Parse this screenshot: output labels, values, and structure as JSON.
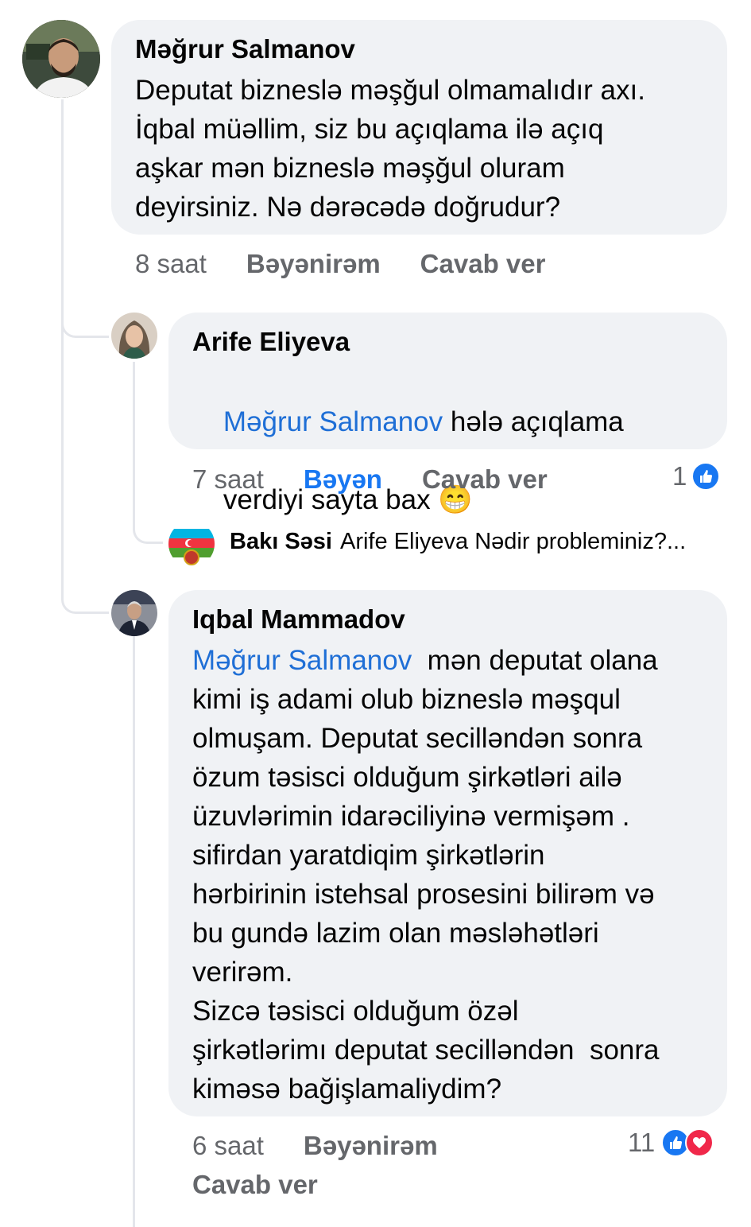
{
  "comments": [
    {
      "author": "Məğrur Salmanov",
      "text": "Deputat bizneslə məşğul olmamalıdır axı.\nİqbal müəllim, siz bu açıqlama ilə açıq\naşkar mən bizneslə məşğul oluram\ndeyirsiniz. Nə dərəcədə doğrudur?",
      "time": "8 saat",
      "like_label": "Bəyənirəm",
      "reply_label": "Cavab ver"
    },
    {
      "author": "Arife Eliyeva",
      "mention": "Məğrur Salmanov",
      "text_line1": " hələ açıqlama",
      "text_line2": "verdiyi sayta bax ",
      "emoji": "😁",
      "time": "7 saat",
      "like_label": "Bəyən",
      "reply_label": "Cavab ver",
      "reaction_count": "1"
    },
    {
      "author": "Iqbal Mammadov",
      "mention": "Məğrur Salmanov",
      "text_first": "  mən deputat olana",
      "text": "kimi iş adami olub bizneslə məşqul\nolmuşam. Deputat secilləndən sonra\nözum təsisci olduğum şirkətləri ailə\nüzuvlərimin idarəciliyinə vermişəm .\nsifirdan yaratdiqim şirkətlərin\nhərbirinin istehsal prosesini bilirəm və\nbu gundə lazim olan məsləhətləri\nverirəm.\nSizcə təsisci olduğum özəl\nşirkətlərimı deputat secilləndən  sonra\nkiməsə bağişlamaliydim?",
      "time": "6 saat",
      "like_label": "Bəyənirəm",
      "reply_label": "Cavab ver",
      "reaction_count": "11"
    }
  ],
  "reply_preview": {
    "author": "Bakı Səsi",
    "text": "Arife Eliyeva Nədir probleminiz?..."
  },
  "colors": {
    "bubble": "#f0f2f5",
    "mention": "#1f6fd6",
    "like_blue": "#1877f2",
    "love_red": "#f0284a",
    "meta_gray": "#65676b"
  }
}
